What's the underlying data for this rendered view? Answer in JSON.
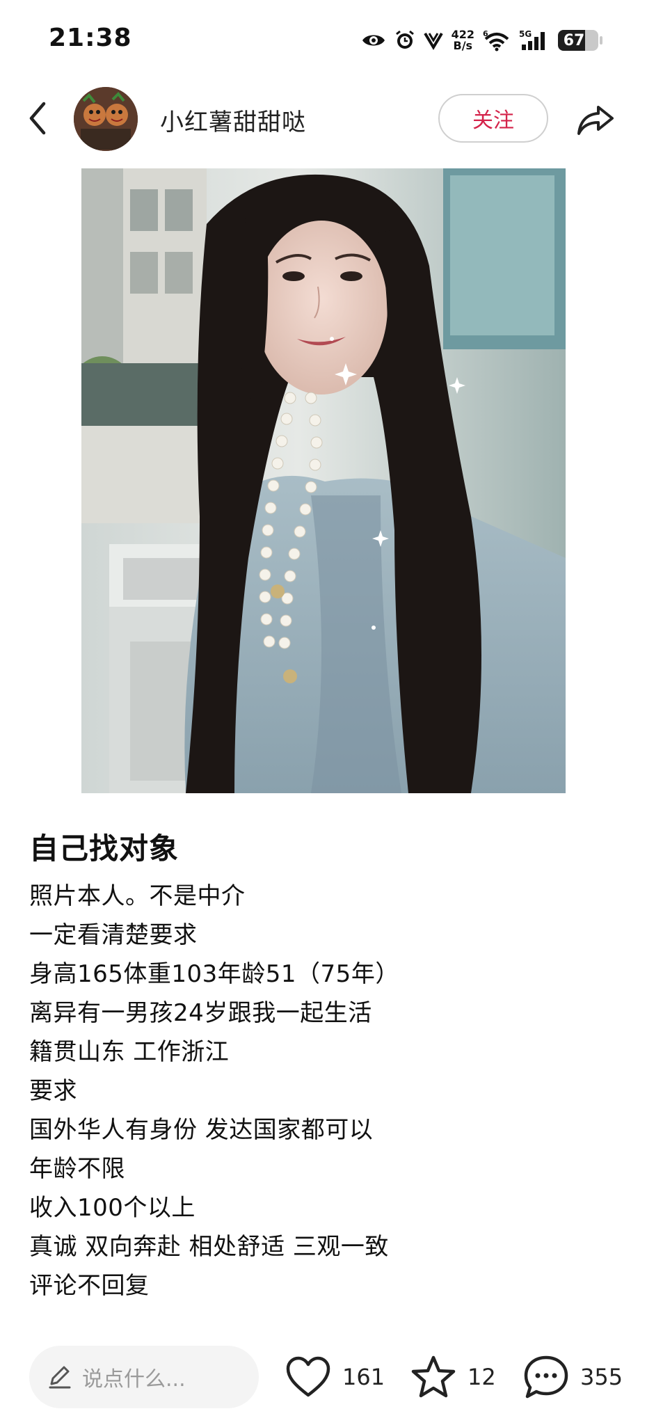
{
  "status_bar": {
    "time": "21:38",
    "net_speed_value": "422",
    "net_speed_unit": "B/s",
    "network_type": "5G",
    "wifi_badge": "6",
    "battery_level": "67"
  },
  "header": {
    "username": "小红薯甜甜哒",
    "follow_label": "关注"
  },
  "post": {
    "title": "自己找对象",
    "lines": [
      "照片本人。不是中介",
      "一定看清楚要求",
      "身高165体重103年龄51（75年）",
      "离异有一男孩24岁跟我一起生活",
      "籍贯山东 工作浙江",
      "要求",
      "国外华人有身份 发达国家都可以",
      "年龄不限",
      "收入100个以上",
      "真诚 双向奔赴 相处舒适 三观一致",
      "评论不回复"
    ]
  },
  "bottom_bar": {
    "comment_placeholder": "说点什么...",
    "likes": "161",
    "collects": "12",
    "comments": "355"
  },
  "icons": {
    "back": "chevron-left-icon",
    "share": "share-arrow-icon",
    "edit": "pencil-icon",
    "like": "heart-icon",
    "collect": "star-icon",
    "comment": "chat-bubble-icon"
  },
  "colors": {
    "accent": "#d4234a",
    "text": "#111111",
    "muted": "#9a9a9a",
    "input_bg": "#f4f4f4"
  }
}
